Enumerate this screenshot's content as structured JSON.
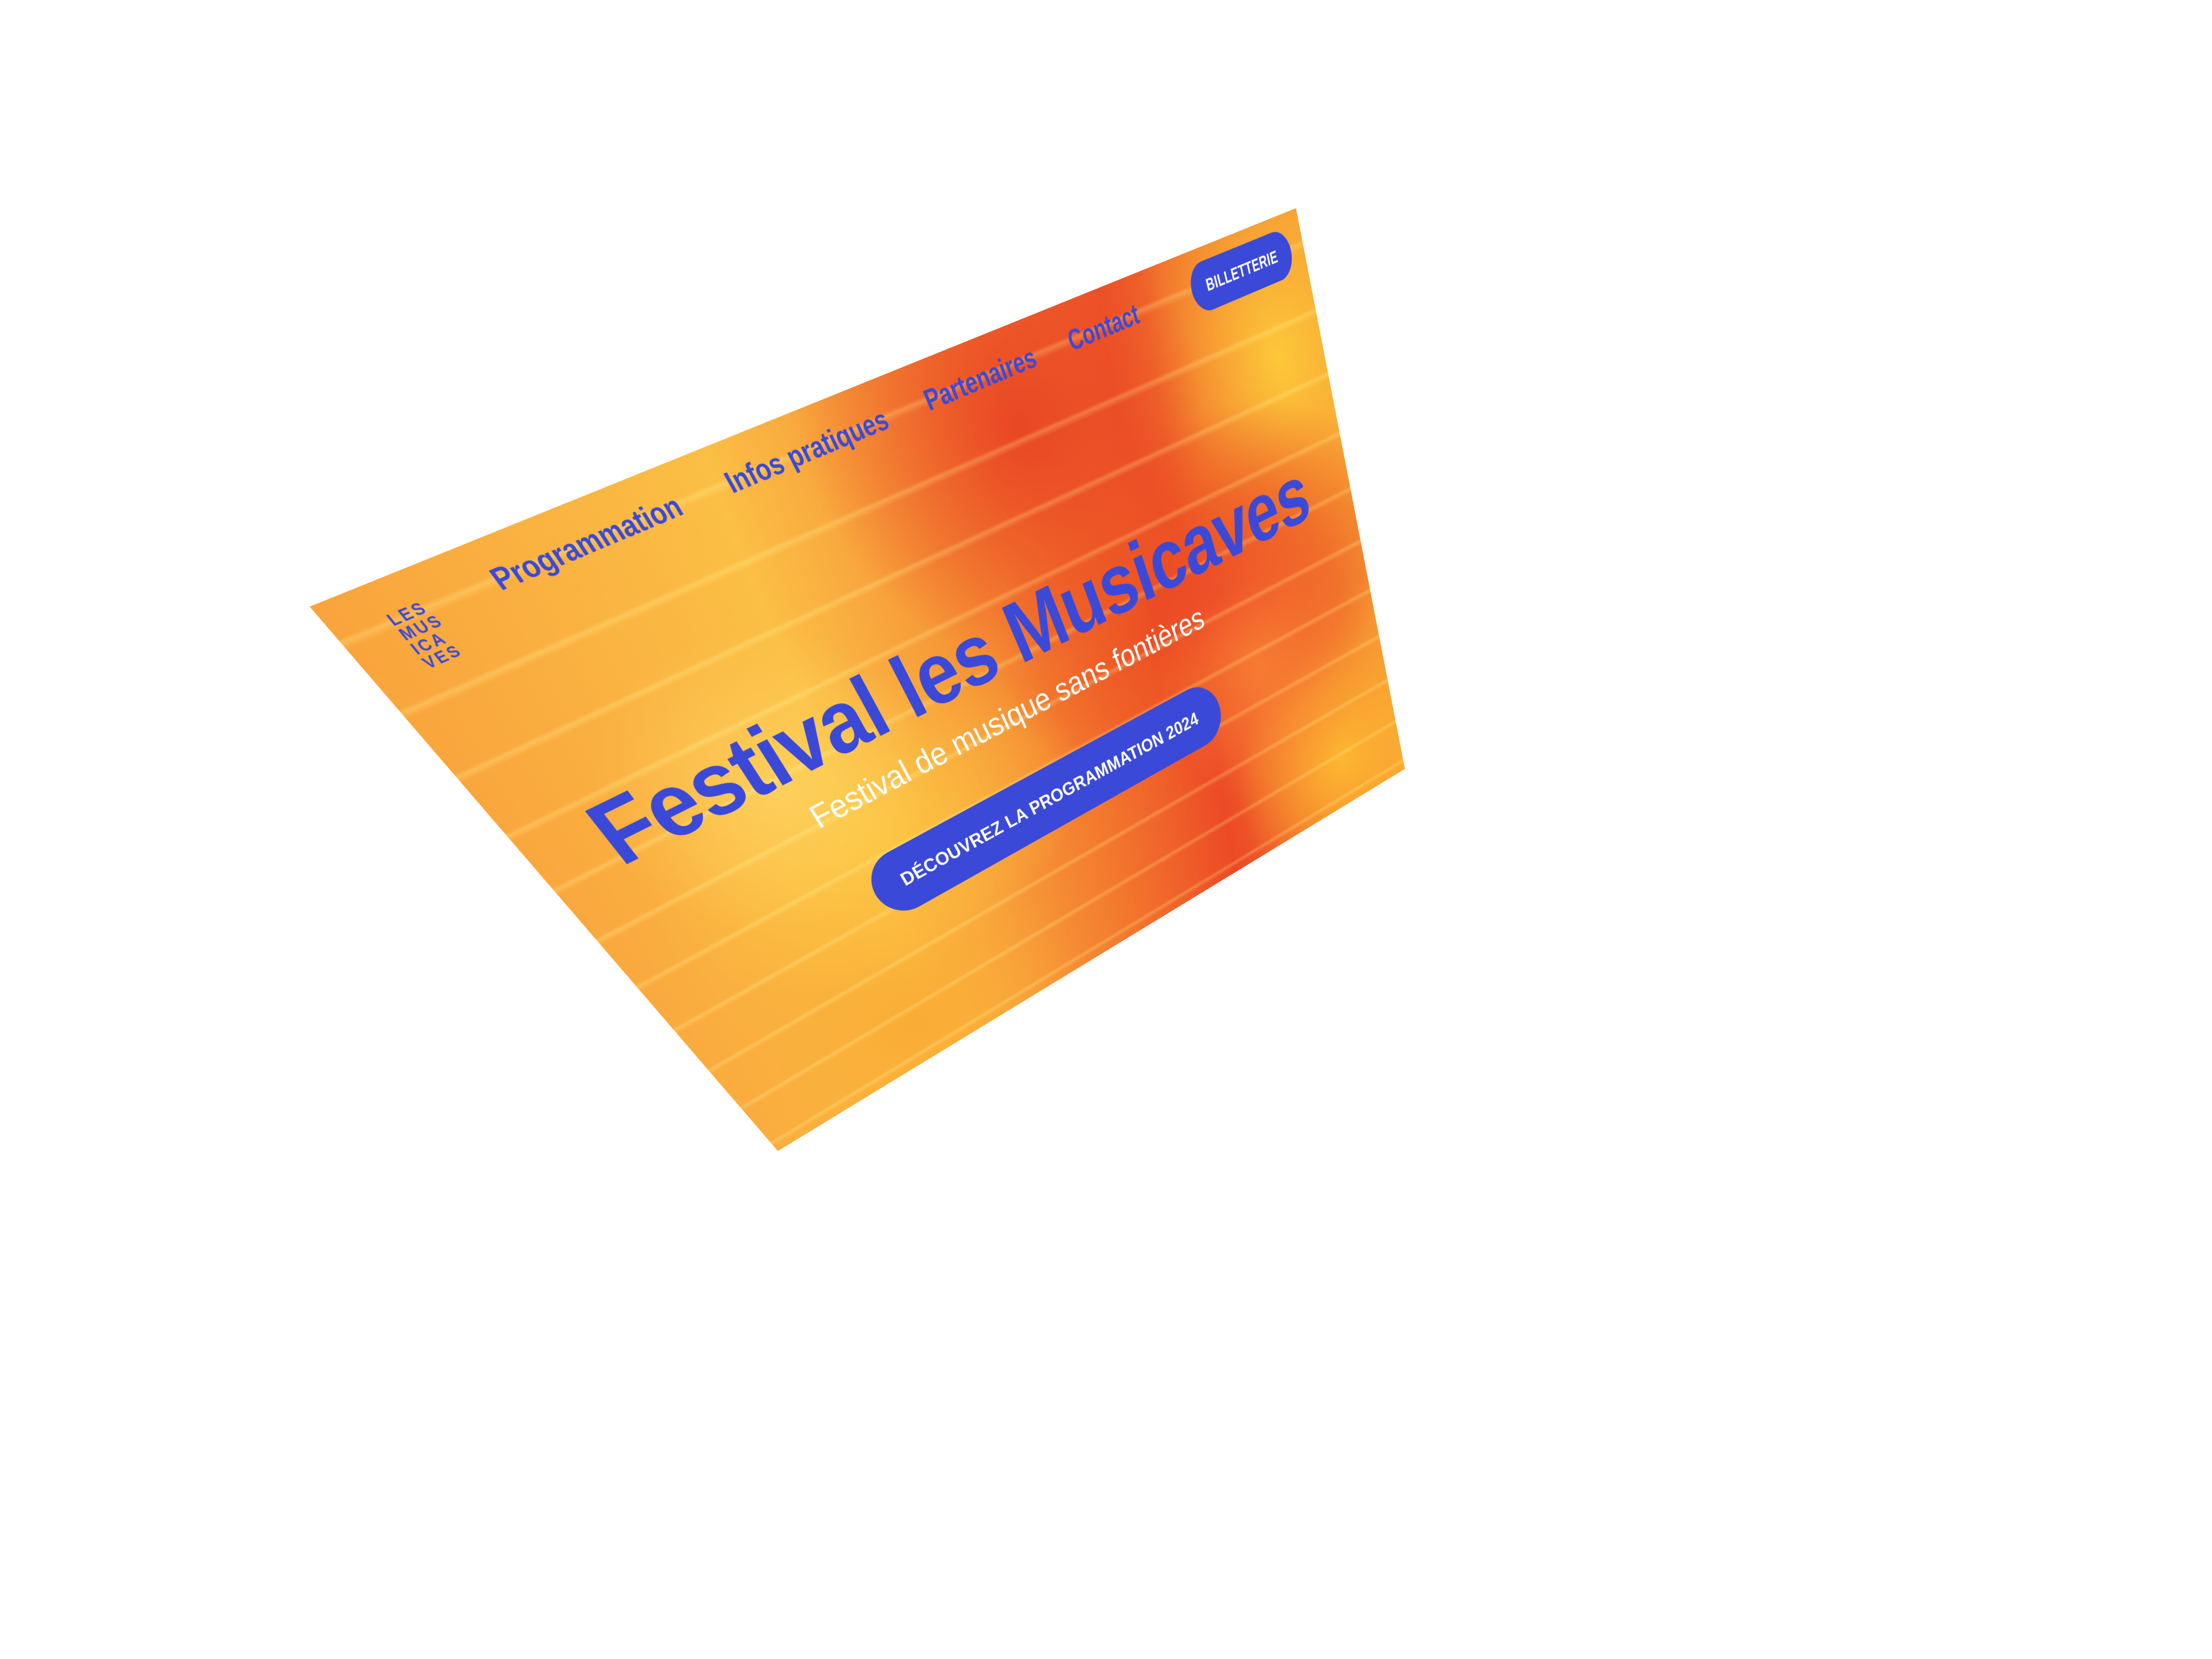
{
  "logo": {
    "lines": [
      "LES",
      "MUS",
      "ICA",
      "VES"
    ]
  },
  "nav": {
    "items": [
      {
        "label": "Programmation"
      },
      {
        "label": "Infos pratiques"
      },
      {
        "label": "Partenaires"
      },
      {
        "label": "Contact"
      }
    ]
  },
  "header": {
    "ticket_label": "BILLETTERIE"
  },
  "hero": {
    "title": "Festival les Musicaves",
    "subtitle": "Festival de musique sans fontières",
    "cta_label": "DÉCOUVREZ LA PROGRAMMATION 2024"
  },
  "colors": {
    "brand_blue": "#3b49d9",
    "background_orange": "#ec4a26",
    "background_yellow": "#fbbf45",
    "button_text": "#ffffff"
  }
}
